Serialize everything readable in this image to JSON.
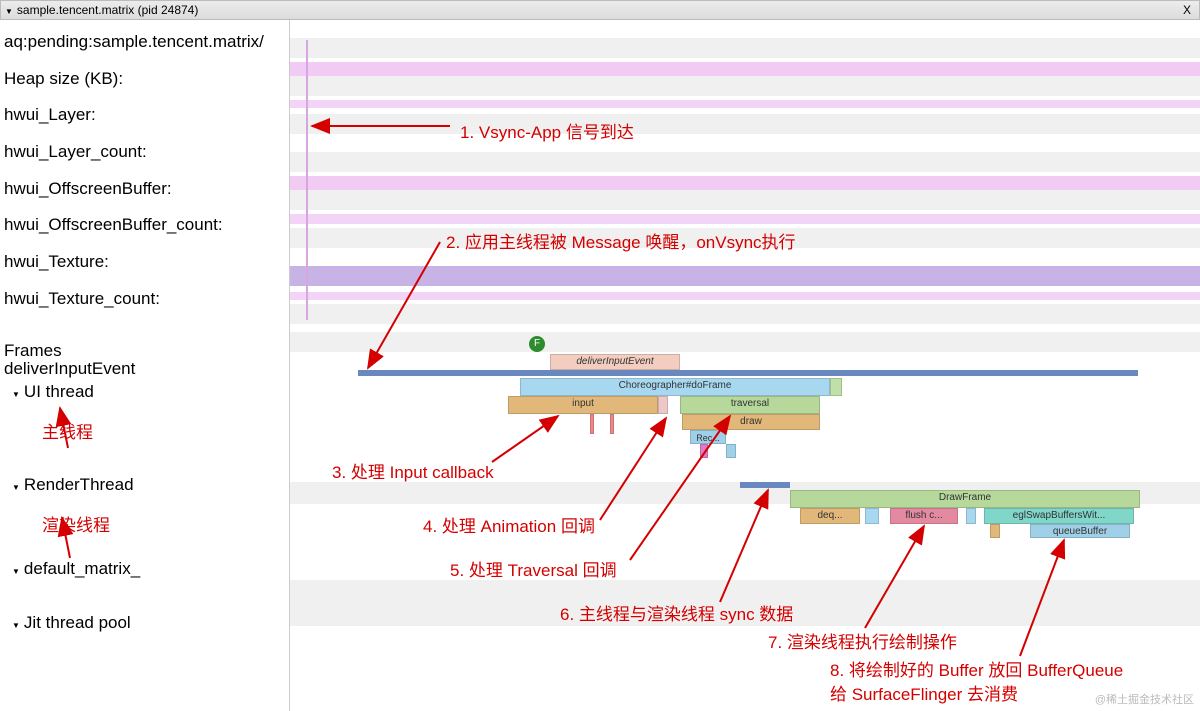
{
  "header": {
    "title": "sample.tencent.matrix (pid 24874)",
    "close": "X"
  },
  "sidebar": {
    "rows": [
      "aq:pending:sample.tencent.matrix/",
      "Heap size (KB):",
      "hwui_Layer:",
      "hwui_Layer_count:",
      "hwui_OffscreenBuffer:",
      "hwui_OffscreenBuffer_count:",
      "hwui_Texture:",
      "hwui_Texture_count:"
    ],
    "frames": "Frames",
    "deliverInputEvent": "deliverInputEvent",
    "tree": {
      "ui_thread": "UI thread",
      "ui_thread_note": "主线程",
      "render_thread": "RenderThread",
      "render_thread_note": "渲染线程",
      "default_matrix": "default_matrix_",
      "jit_thread": "Jit thread pool"
    }
  },
  "timeline": {
    "frame_badge": "F",
    "segments": {
      "deliverInputEvent": "deliverInputEvent",
      "choreographer": "Choreographer#doFrame",
      "input": "input",
      "traversal": "traversal",
      "draw": "draw",
      "rec": "Rec...",
      "drawFrame": "DrawFrame",
      "deq": "deq...",
      "flush": "flush c...",
      "eglSwap": "eglSwapBuffersWit...",
      "queueBuffer": "queueBuffer"
    }
  },
  "annotations": {
    "a1": "1. Vsync-App 信号到达",
    "a2": "2. 应用主线程被 Message 唤醒，onVsync执行",
    "a3": "3. 处理 Input callback",
    "a4": "4. 处理 Animation 回调",
    "a5": "5. 处理 Traversal 回调",
    "a6": "6. 主线程与渲染线程 sync 数据",
    "a7": "7. 渲染线程执行绘制操作",
    "a8a": "8. 将绘制好的 Buffer 放回 BufferQueue",
    "a8b": "给 SurfaceFlinger 去消费"
  },
  "watermark": "@稀土掘金技术社区"
}
